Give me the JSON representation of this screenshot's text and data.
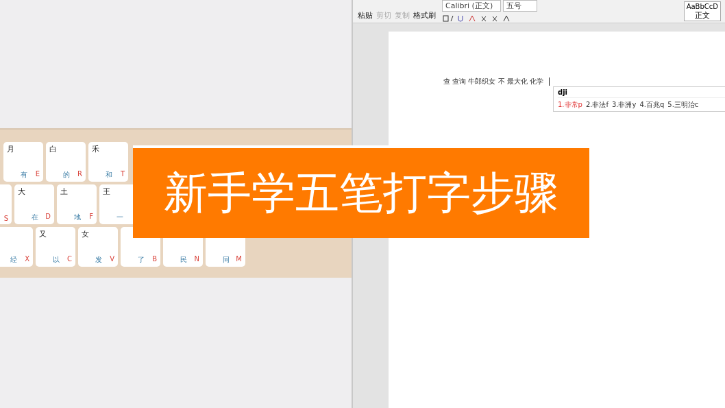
{
  "banner": {
    "title": "新手学五笔打字步骤"
  },
  "keyboard": {
    "rows": [
      {
        "keys": [
          {
            "root": "月",
            "word": "有",
            "letter": "E"
          },
          {
            "root": "白",
            "word": "的",
            "letter": "R"
          },
          {
            "root": "禾",
            "word": "和",
            "letter": "T"
          }
        ]
      },
      {
        "keys": [
          {
            "letter": "S"
          },
          {
            "root": "大",
            "word": "在",
            "letter": "D"
          },
          {
            "root": "土",
            "word": "地",
            "letter": "F"
          },
          {
            "root": "王",
            "word": "一"
          }
        ]
      },
      {
        "keys": [
          {
            "word": "经",
            "letter": "X"
          },
          {
            "root": "又",
            "word": "以",
            "letter": "C"
          },
          {
            "root": "女",
            "word": "发",
            "letter": "V"
          },
          {
            "word": "了",
            "letter": "B"
          },
          {
            "word": "民",
            "letter": "N"
          },
          {
            "word": "同",
            "letter": "M"
          }
        ]
      }
    ]
  },
  "toolbar": {
    "clipboard": [
      {
        "label": "粘贴",
        "disabled": false
      },
      {
        "label": "剪切",
        "disabled": true
      },
      {
        "label": "复制",
        "disabled": true
      },
      {
        "label": "格式刷",
        "disabled": false
      }
    ],
    "font": "Calibri (正文)",
    "size": "五号",
    "style_preview": "AaBbCcD",
    "style_name": "正文"
  },
  "document": {
    "line": "查 查询 牛郎织女 不 最大化 化学"
  },
  "ime": {
    "input": "dji",
    "candidates": [
      {
        "label": "1.非常p",
        "selected": true
      },
      {
        "label": "2.非法f",
        "selected": false
      },
      {
        "label": "3.非洲y",
        "selected": false
      },
      {
        "label": "4.百兆q",
        "selected": false
      },
      {
        "label": "5.三明治c",
        "selected": false
      }
    ]
  }
}
